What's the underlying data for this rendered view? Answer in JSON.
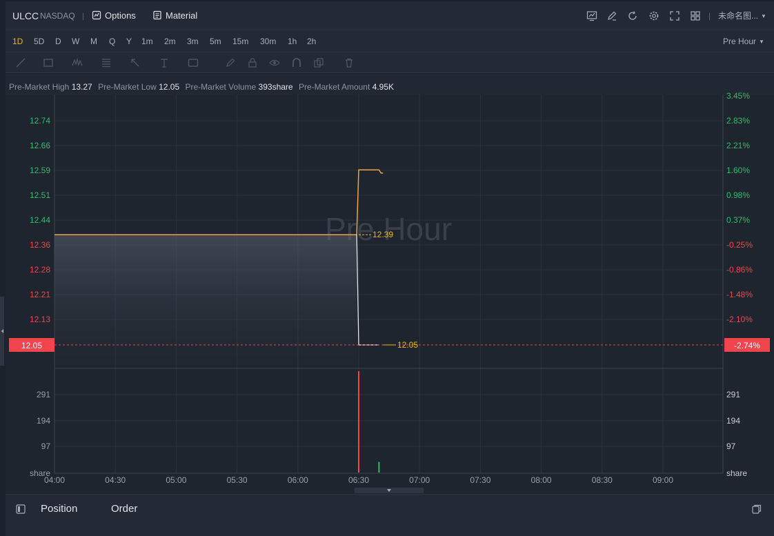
{
  "header": {
    "symbol": "ULCC",
    "exchange": "NASDAQ",
    "separator": "|",
    "options_label": "Options",
    "material_label": "Material",
    "layout_name": "未命名图..."
  },
  "periods": {
    "items": [
      "1D",
      "5D",
      "D",
      "W",
      "M",
      "Q",
      "Y",
      "1m",
      "2m",
      "3m",
      "5m",
      "15m",
      "30m",
      "1h",
      "2h"
    ],
    "active": "1D",
    "session_label": "Pre Hour"
  },
  "stats": {
    "high_label": "Pre-Market High",
    "high_value": "13.27",
    "low_label": "Pre-Market Low",
    "low_value": "12.05",
    "volume_label": "Pre-Market Volume",
    "volume_value": "393share",
    "amount_label": "Pre-Market Amount",
    "amount_value": "4.95K"
  },
  "watermark": "Pre Hour",
  "colors": {
    "up": "#2ebd6b",
    "down": "#f0454d",
    "price_line": "#f0a040",
    "current_line": "#e8e8e8",
    "last_price_tag": "#f0454d",
    "price_label": "#f0b90b"
  },
  "chart_data": {
    "type": "line",
    "x_ticks": [
      "04:00",
      "04:30",
      "05:00",
      "05:30",
      "06:00",
      "06:30",
      "07:00",
      "07:30",
      "08:00",
      "08:30",
      "09:00"
    ],
    "y_left_ticks": [
      "12.74",
      "12.66",
      "12.59",
      "12.51",
      "12.44",
      "12.36",
      "12.28",
      "12.21",
      "12.13"
    ],
    "y_right_ticks": [
      "3.45%",
      "2.83%",
      "2.21%",
      "1.60%",
      "0.98%",
      "0.37%",
      "-0.25%",
      "-0.86%",
      "-1.48%",
      "-2.10%"
    ],
    "prev_close": 12.39,
    "last_price": 12.05,
    "last_price_label": "12.05",
    "last_change_label": "-2.74%",
    "prev_close_label": "12.39",
    "series": [
      {
        "x": [
          "04:00",
          "06:29",
          "06:30",
          "06:31",
          "06:40",
          "06:41",
          "06:42"
        ],
        "values": [
          12.39,
          12.39,
          12.59,
          12.59,
          12.59,
          12.58,
          12.58
        ]
      },
      {
        "x": [
          "06:29",
          "06:30",
          "06:40"
        ],
        "values": [
          12.39,
          12.05,
          12.05
        ]
      }
    ],
    "volume": {
      "unit_label": "share",
      "y_ticks": [
        "291",
        "194",
        "97"
      ],
      "bars": [
        {
          "x": "06:30",
          "value": 380,
          "direction": "down"
        },
        {
          "x": "06:40",
          "value": 40,
          "direction": "up"
        }
      ]
    }
  },
  "bottom": {
    "position_label": "Position",
    "order_label": "Order"
  }
}
